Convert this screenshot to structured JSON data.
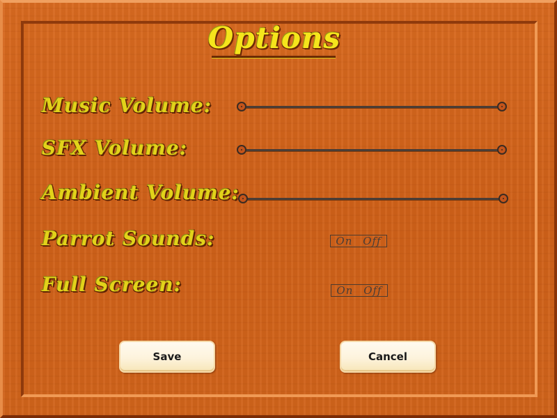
{
  "dialog": {
    "title": "Options"
  },
  "settings": {
    "music_volume": {
      "label": "Music Volume:",
      "value": 1.0
    },
    "sfx_volume": {
      "label": "SFX Volume:",
      "value": 1.0
    },
    "ambient_volume": {
      "label": "Ambient Volume:",
      "value": 1.0
    },
    "parrot_sounds": {
      "label": "Parrot Sounds:",
      "on": "On",
      "off": "Off"
    },
    "full_screen": {
      "label": "Full Screen:",
      "on": "On",
      "off": "Off"
    }
  },
  "buttons": {
    "save": "Save",
    "cancel": "Cancel"
  },
  "colors": {
    "wood": "#cf6119",
    "label_text": "#e2d21a",
    "title_text": "#f5e51c",
    "button_face": "#fdf3dc"
  }
}
